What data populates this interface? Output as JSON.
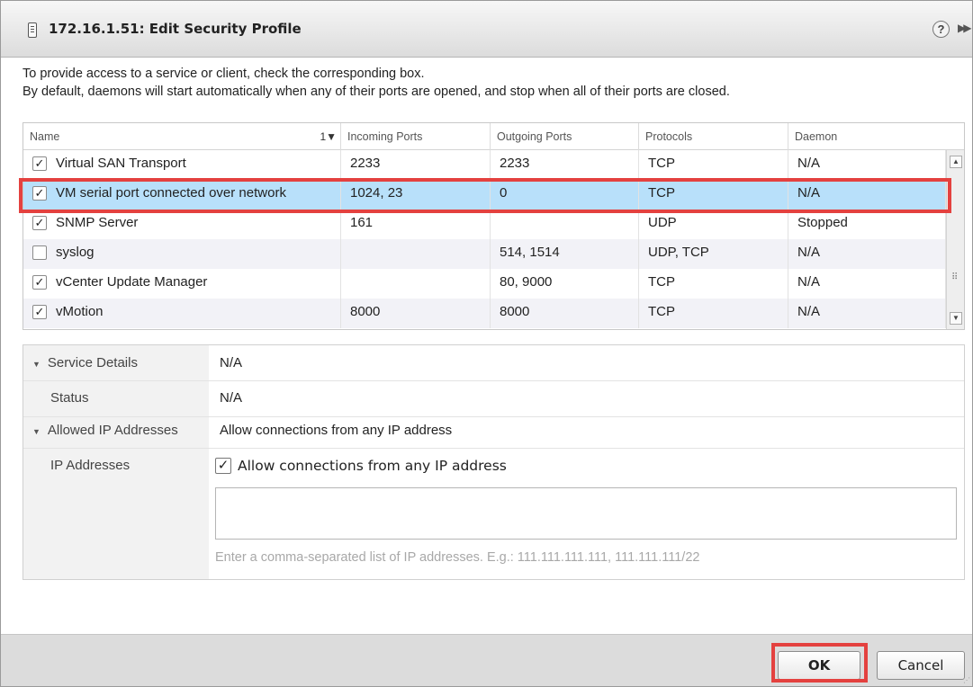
{
  "window": {
    "title": "172.16.1.51: Edit Security Profile",
    "help_icon": "help-icon",
    "help_glyph": "?",
    "expand_glyph": "▶▶"
  },
  "intro": {
    "line1": "To provide access to a service or client, check the corresponding box.",
    "line2": "By default, daemons will start automatically when any of their ports are opened, and stop when all of their ports are closed."
  },
  "table": {
    "columns": {
      "name": "Name",
      "sort": "1▼",
      "incoming": "Incoming Ports",
      "outgoing": "Outgoing Ports",
      "protocols": "Protocols",
      "daemon": "Daemon"
    },
    "rows": [
      {
        "checked": true,
        "name": "Virtual SAN Transport",
        "incoming": "2233",
        "outgoing": "2233",
        "protocols": "TCP",
        "daemon": "N/A"
      },
      {
        "checked": true,
        "name": "VM serial port connected over network",
        "incoming": "1024, 23",
        "outgoing": "0",
        "protocols": "TCP",
        "daemon": "N/A"
      },
      {
        "checked": true,
        "name": "SNMP Server",
        "incoming": "161",
        "outgoing": "",
        "protocols": "UDP",
        "daemon": "Stopped"
      },
      {
        "checked": false,
        "name": "syslog",
        "incoming": "",
        "outgoing": "514, 1514",
        "protocols": "UDP, TCP",
        "daemon": "N/A"
      },
      {
        "checked": true,
        "name": "vCenter Update Manager",
        "incoming": "",
        "outgoing": "80, 9000",
        "protocols": "TCP",
        "daemon": "N/A"
      },
      {
        "checked": true,
        "name": "vMotion",
        "incoming": "8000",
        "outgoing": "8000",
        "protocols": "TCP",
        "daemon": "N/A"
      }
    ],
    "selected_row": "VM serial port connected over network"
  },
  "details": {
    "service_details_label": "Service Details",
    "service_details_value": "N/A",
    "status_label": "Status",
    "status_value": "N/A",
    "allowed_ip_label": "Allowed IP Addresses",
    "allowed_ip_value": "Allow connections from any IP address",
    "ip_addresses_label": "IP Addresses",
    "allow_any_checked": true,
    "allow_any_label": "Allow connections from any IP address",
    "ip_list_value": "",
    "ip_hint": "Enter a comma-separated list of IP addresses. E.g.: 111.111.111.111, 111.111.111/22"
  },
  "footer": {
    "ok_label": "OK",
    "cancel_label": "Cancel"
  },
  "colors": {
    "selected_row": "#b8e0fa",
    "highlight": "#e4413f",
    "alt_row": "#f2f2f7"
  }
}
